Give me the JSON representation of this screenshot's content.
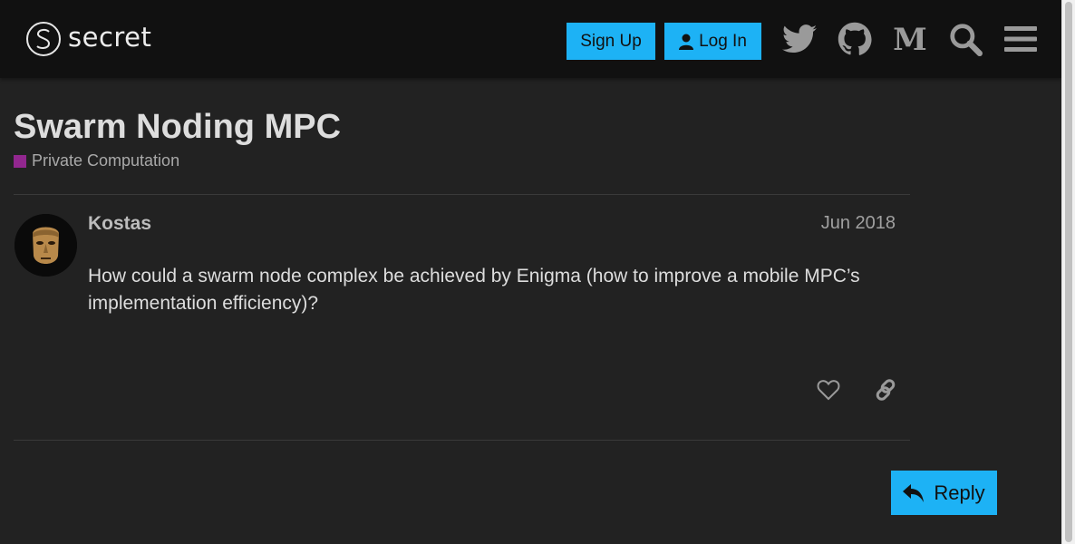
{
  "header": {
    "logo_text": "secret",
    "signup_label": "Sign Up",
    "login_label": "Log In",
    "icons": [
      "twitter-icon",
      "github-icon",
      "medium-icon",
      "search-icon",
      "menu-icon"
    ],
    "accent_color": "#1db2f5"
  },
  "topic": {
    "title": "Swarm Noding MPC",
    "category": "Private Computation",
    "category_color": "#92278f"
  },
  "post": {
    "author": "Kostas",
    "date": "Jun 2018",
    "body": "How could a swarm node complex be achieved by Enigma (how to improve a mobile MPC’s implementation efficiency)?"
  },
  "footer": {
    "reply_label": "Reply"
  }
}
